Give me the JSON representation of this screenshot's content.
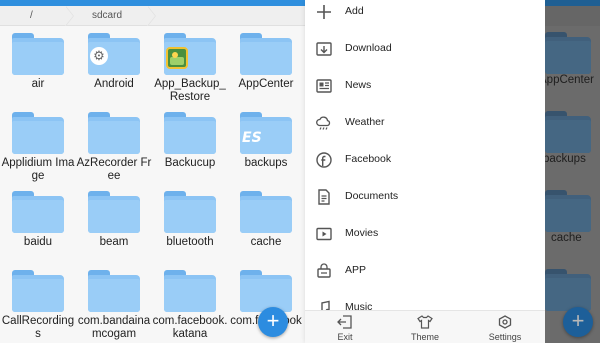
{
  "breadcrumb": {
    "root": "/",
    "current": "sdcard"
  },
  "folders": [
    {
      "name": "air",
      "badge": ""
    },
    {
      "name": "Android",
      "badge": "gear"
    },
    {
      "name": "App_Backup_Restore",
      "badge": "app"
    },
    {
      "name": "AppCenter",
      "badge": ""
    },
    {
      "name": "Applidium Image",
      "badge": ""
    },
    {
      "name": "AzRecorder Free",
      "badge": ""
    },
    {
      "name": "Backucup",
      "badge": ""
    },
    {
      "name": "backups",
      "badge": "es"
    },
    {
      "name": "baidu",
      "badge": ""
    },
    {
      "name": "beam",
      "badge": ""
    },
    {
      "name": "bluetooth",
      "badge": ""
    },
    {
      "name": "cache",
      "badge": ""
    },
    {
      "name": "CallRecordings",
      "badge": ""
    },
    {
      "name": "com.bandainamcogam",
      "badge": ""
    },
    {
      "name": "com.facebook.katana",
      "badge": ""
    },
    {
      "name": "com.facebook",
      "badge": ""
    }
  ],
  "badge_text": {
    "es": "ES"
  },
  "fab_icon": "+",
  "drawer": {
    "items": [
      {
        "label": "Add",
        "icon": "plus-icon"
      },
      {
        "label": "Download",
        "icon": "download-icon"
      },
      {
        "label": "News",
        "icon": "news-icon"
      },
      {
        "label": "Weather",
        "icon": "weather-icon"
      },
      {
        "label": "Facebook",
        "icon": "facebook-icon"
      },
      {
        "label": "Documents",
        "icon": "documents-icon"
      },
      {
        "label": "Movies",
        "icon": "movies-icon"
      },
      {
        "label": "APP",
        "icon": "app-icon"
      },
      {
        "label": "Music",
        "icon": "music-icon"
      }
    ],
    "bottom": [
      {
        "label": "Exit",
        "icon": "exit-icon"
      },
      {
        "label": "Theme",
        "icon": "theme-icon"
      },
      {
        "label": "Settings",
        "icon": "settings-icon"
      }
    ]
  },
  "background_labels": [
    "AppCenter",
    "backups",
    "cache"
  ],
  "colors": {
    "accent": "#2c8ce0",
    "folder": "#9acdf7",
    "overlay": "#6b6b6b"
  }
}
